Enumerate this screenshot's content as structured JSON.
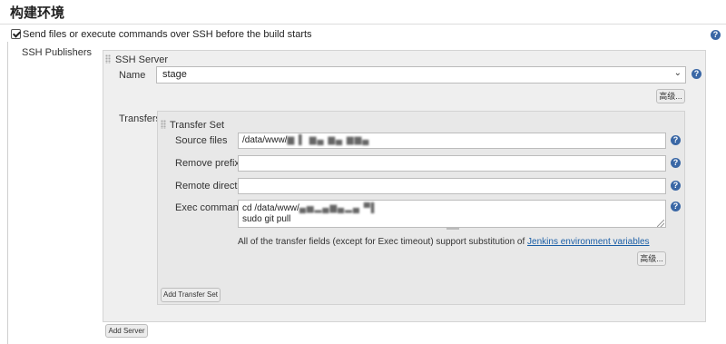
{
  "section": {
    "title": "构建环境"
  },
  "ssh_option": {
    "label": "Send files or execute commands over SSH before the build starts",
    "checked": true
  },
  "left_label": "SSH Publishers",
  "server": {
    "title": "SSH Server",
    "name_label": "Name",
    "name_value": "stage",
    "advanced_label": "高级..."
  },
  "transfers": {
    "label": "Transfers",
    "set_title": "Transfer Set",
    "source_files": {
      "label": "Source files",
      "value_prefix": "/data/www/",
      "value_blurred": "▆ ▌ ▆▄ ▆▄ ▆▆▄"
    },
    "remove_prefix": {
      "label": "Remove prefix",
      "value": ""
    },
    "remote_directory": {
      "label": "Remote directory",
      "value": ""
    },
    "exec_command": {
      "label": "Exec command",
      "line1_prefix": "cd /data/www/",
      "line1_blurred": "▄▅▂▄▆▄▂▄ ▀▌",
      "line2": "sudo git pull"
    },
    "hint_text": "All of the transfer fields (except for Exec timeout) support substitution of ",
    "hint_link": "Jenkins environment variables",
    "advanced_label": "高级...",
    "add_transfer_label": "Add Transfer Set"
  },
  "add_server_label": "Add Server",
  "help_icon_glyph": "?",
  "select_chevron": "⌄"
}
